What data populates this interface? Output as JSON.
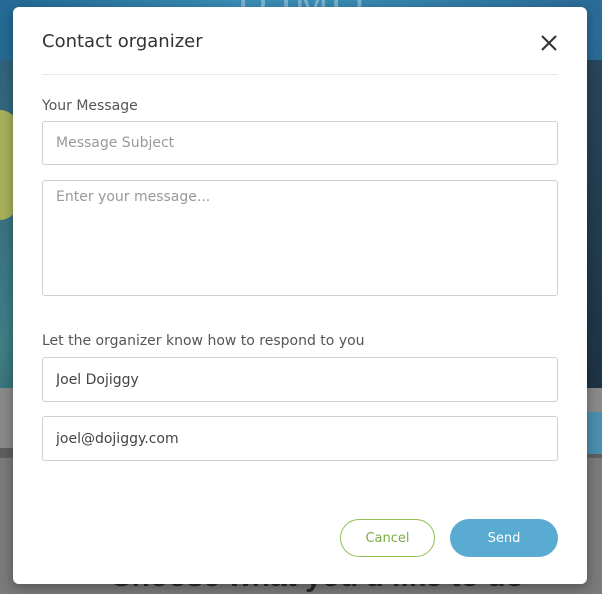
{
  "modal": {
    "title": "Contact organizer",
    "close_icon": "close-icon"
  },
  "message_section": {
    "label": "Your Message",
    "subject_placeholder": "Message Subject",
    "subject_value": "",
    "message_placeholder": "Enter your message...",
    "message_value": ""
  },
  "respond_section": {
    "label": "Let the organizer know how to respond to you",
    "name_value": "Joel Dojiggy",
    "email_value": "joel@dojiggy.com"
  },
  "buttons": {
    "cancel_label": "Cancel",
    "send_label": "Send"
  },
  "background": {
    "heading": "Choose what you'd like to do",
    "logo_text": "DJMO"
  },
  "colors": {
    "cancel_border": "#8cc152",
    "cancel_text": "#7aab47",
    "send_bg": "#5aabd2",
    "title": "#333333"
  }
}
